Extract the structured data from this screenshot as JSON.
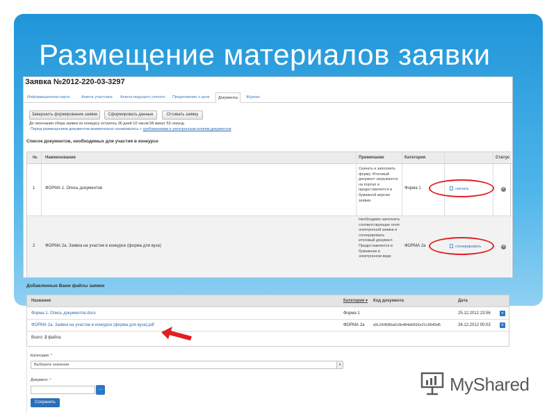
{
  "slide": {
    "title": "Размещение материалов заявки",
    "bg_color": "#1f95d8"
  },
  "app": {
    "request_title": "Заявка №2012-220-03-3297",
    "tabs": [
      {
        "label": "Информационная карта"
      },
      {
        "label": "Анкета участника"
      },
      {
        "label": "Анкета ведущего ученого"
      },
      {
        "label": "Предложение о цене"
      },
      {
        "label": "Документы",
        "active": true
      },
      {
        "label": "Журнал"
      }
    ],
    "buttons": {
      "finish": "Завершить формирование заявки",
      "generate": "Сформировать данные",
      "withdraw": "Отозвать заявку"
    },
    "deadline_text": "До окончания сбора заявок по конкурсу осталось 36 дней 10 часов 58 минут 53 секунд.",
    "notice_prefix": "Перед размещением документов внимательно ознакомьтесь с ",
    "notice_link": "требованиями к электронным копиям документов",
    "docs_section_title": "Список документов, необходимых для участия в конкурсе",
    "docs_table": {
      "headers": {
        "num": "№",
        "name": "Наименование",
        "note": "Примечание",
        "category": "Категория",
        "status": "Статус"
      },
      "rows": [
        {
          "num": "1",
          "name": "ФОРМА 1. Опись документов",
          "note": "Скачать и заполнить форму. Итоговый документ загружается на портал и предоставляется в бумажной версии заявки.",
          "category": "Форма 1",
          "action": "скачать",
          "status_icon": "remove-icon"
        },
        {
          "num": "2",
          "name": "ФОРМА 2а. Заявка на участие в конкурсе (форма для вуза)",
          "note": "Необходимо заполнить соответствующие поля электронной заявки и сгенерировать итоговый документ. Предоставляется в бумажном и электронном виде",
          "category": "ФОРМА 2а",
          "action": "сгенерировать",
          "status_icon": "remove-icon"
        }
      ]
    }
  },
  "files": {
    "section_title": "Добавленные Вами файлы заявки",
    "headers": {
      "name": "Название",
      "category": "Категория",
      "code": "Код документа",
      "date": "Дата"
    },
    "rows": [
      {
        "name": "Форма 1. Опись документов.docx",
        "category": "Форма 1",
        "code": "",
        "date": "25.12.2012 23:56"
      },
      {
        "name": "ФОРМА 2а. Заявка на участие в конкурсе (форма для вуза).pdf",
        "category": "ФОРМА 2а",
        "code": "d3c244580a0c6b484db592e21c9545d5",
        "date": "26.12.2012 00:03"
      }
    ],
    "total_label": "Всего:",
    "total_count": "2",
    "total_suffix": "файла"
  },
  "upload_form": {
    "category_label": "Категория:",
    "category_placeholder": "Выберите значение",
    "document_label": "Документ:",
    "browse_label": "...",
    "save_label": "Сохранить"
  },
  "watermark": {
    "text": "MyShared"
  },
  "colors": {
    "accent": "#2a6fba",
    "highlight": "#e01e24"
  }
}
